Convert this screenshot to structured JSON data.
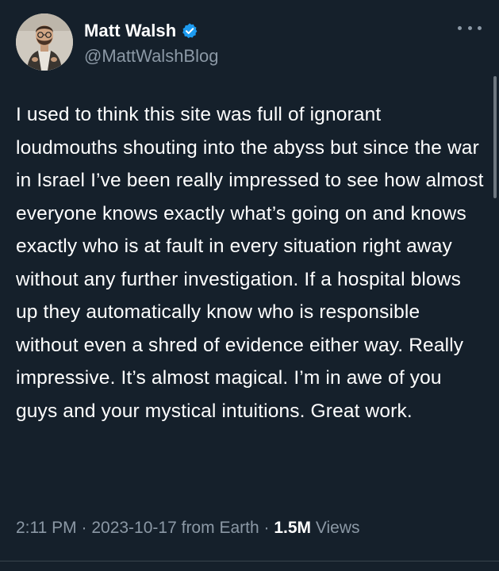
{
  "author": {
    "display_name": "Matt Walsh",
    "handle": "@MattWalshBlog",
    "verified": true,
    "verified_color": "#1d9bf0"
  },
  "tweet": {
    "text": "I used to think this site was full of ignorant loudmouths shouting into the abyss but since the war in Israel I’ve been really impressed to see how almost everyone knows exactly what’s going on and knows exactly who is at fault in every situation right away without any further investigation. If a hospital blows up they automatically know who is responsible without even a shred of evidence either way. Really impressive. It’s almost magical. I’m in awe of you guys and your mystical intuitions. Great work."
  },
  "meta": {
    "time": "2:11 PM",
    "separator": "·",
    "date": "2023-10-17",
    "source": "from Earth",
    "views_count": "1.5M",
    "views_label": "Views"
  },
  "icons": {
    "more": "more-options-icon",
    "verified": "verified-badge-icon"
  },
  "colors": {
    "background": "#15202b",
    "text_primary": "#ffffff",
    "text_secondary": "#8b98a5"
  }
}
